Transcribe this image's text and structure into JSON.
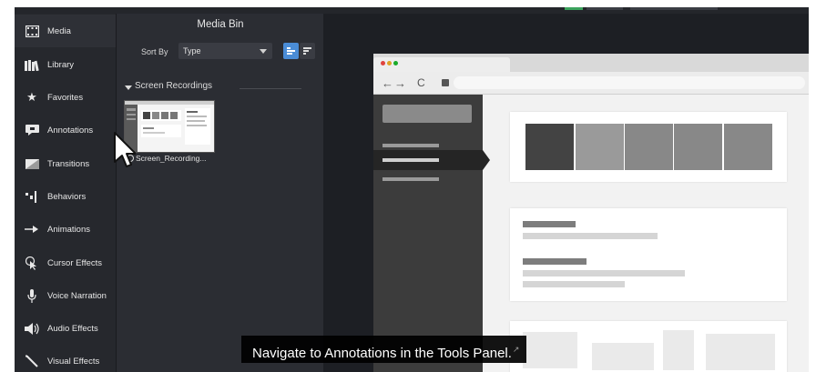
{
  "tools_panel": {
    "items": [
      {
        "label": "Media",
        "icon": "filmstrip-icon"
      },
      {
        "label": "Library",
        "icon": "books-icon"
      },
      {
        "label": "Favorites",
        "icon": "star-icon"
      },
      {
        "label": "Annotations",
        "icon": "speech-bubble-icon"
      },
      {
        "label": "Transitions",
        "icon": "transition-icon"
      },
      {
        "label": "Behaviors",
        "icon": "behaviors-icon"
      },
      {
        "label": "Animations",
        "icon": "animation-arrow-icon"
      },
      {
        "label": "Cursor Effects",
        "icon": "cursor-effect-icon"
      },
      {
        "label": "Voice Narration",
        "icon": "microphone-icon"
      },
      {
        "label": "Audio Effects",
        "icon": "speaker-icon"
      },
      {
        "label": "Visual Effects",
        "icon": "magic-wand-icon"
      }
    ]
  },
  "media_bin": {
    "title": "Media Bin",
    "sort_label": "Sort By",
    "sort_value": "Type",
    "group_label": "Screen Recordings",
    "clip_name": "Screen_Recording..."
  },
  "caption": {
    "text": "Navigate to Annotations in the Tools Panel."
  },
  "colors": {
    "accent_blue": "#4a8cd6",
    "panel_dark": "#26282d",
    "caption_bg": "#000000"
  }
}
